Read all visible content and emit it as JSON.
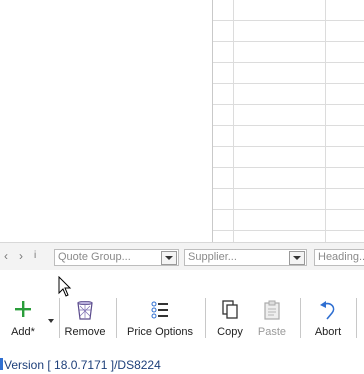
{
  "filter_bar": {
    "prev_symbol": "‹",
    "next_symbol": "›",
    "info_symbol": "i",
    "quote_group_placeholder": "Quote Group...",
    "supplier_placeholder": "Supplier...",
    "heading_placeholder": "Heading..."
  },
  "toolbar": {
    "add_label": "Add*",
    "remove_label": "Remove",
    "price_options_label": "Price Options",
    "copy_label": "Copy",
    "paste_label": "Paste",
    "abort_label": "Abort"
  },
  "status": {
    "version_text": "Version [ 18.0.7171 ]/DS8224"
  },
  "colors": {
    "accent": "#2f6fd1",
    "add_icon": "#2a9d3a",
    "grid_line": "#dcdcdc"
  }
}
